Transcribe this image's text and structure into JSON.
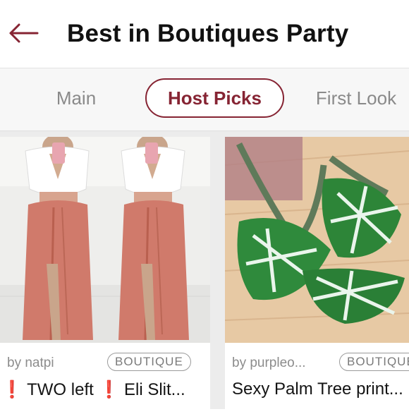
{
  "header": {
    "back_icon": "arrow-left-icon",
    "title": "Best in Boutiques Party",
    "accent_color": "#862433"
  },
  "tabs": [
    {
      "label": "Main",
      "active": false
    },
    {
      "label": "Host Picks",
      "active": true
    },
    {
      "label": "First Look",
      "active": false
    }
  ],
  "listings": [
    {
      "seller": "by natpi",
      "badge": "BOUTIQUE",
      "title": "❗ TWO left ❗ Eli Slit...",
      "image": "Model in white crop top and pink slit maxi skirt, two poses"
    },
    {
      "seller": "by purpleo...",
      "badge": "BOUTIQUE",
      "title": "Sexy Palm Tree print...",
      "image": "Palm leaf print bikini on wooden surface"
    }
  ]
}
